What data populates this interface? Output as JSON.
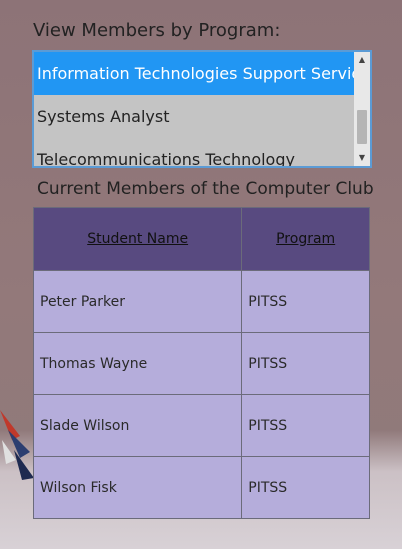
{
  "program_filter": {
    "heading": "View Members by Program:",
    "options": [
      "Information Technologies Support Services",
      "Systems Analyst",
      "Telecommunications Technology"
    ],
    "selected_index": 0
  },
  "members": {
    "caption": "Current Members of the Computer Club",
    "columns": [
      "Student Name",
      "Program"
    ],
    "rows": [
      [
        "Peter Parker",
        "PITSS"
      ],
      [
        "Thomas Wayne",
        "PITSS"
      ],
      [
        "Slade Wilson",
        "PITSS"
      ],
      [
        "Wilson Fisk",
        "PITSS"
      ]
    ]
  },
  "colors": {
    "selected_option": "#2196f3",
    "table_header": "#584a80",
    "table_cell": "#b5addb"
  },
  "icons": {
    "scroll_up": "triangle-up-icon",
    "scroll_down": "triangle-down-icon"
  }
}
